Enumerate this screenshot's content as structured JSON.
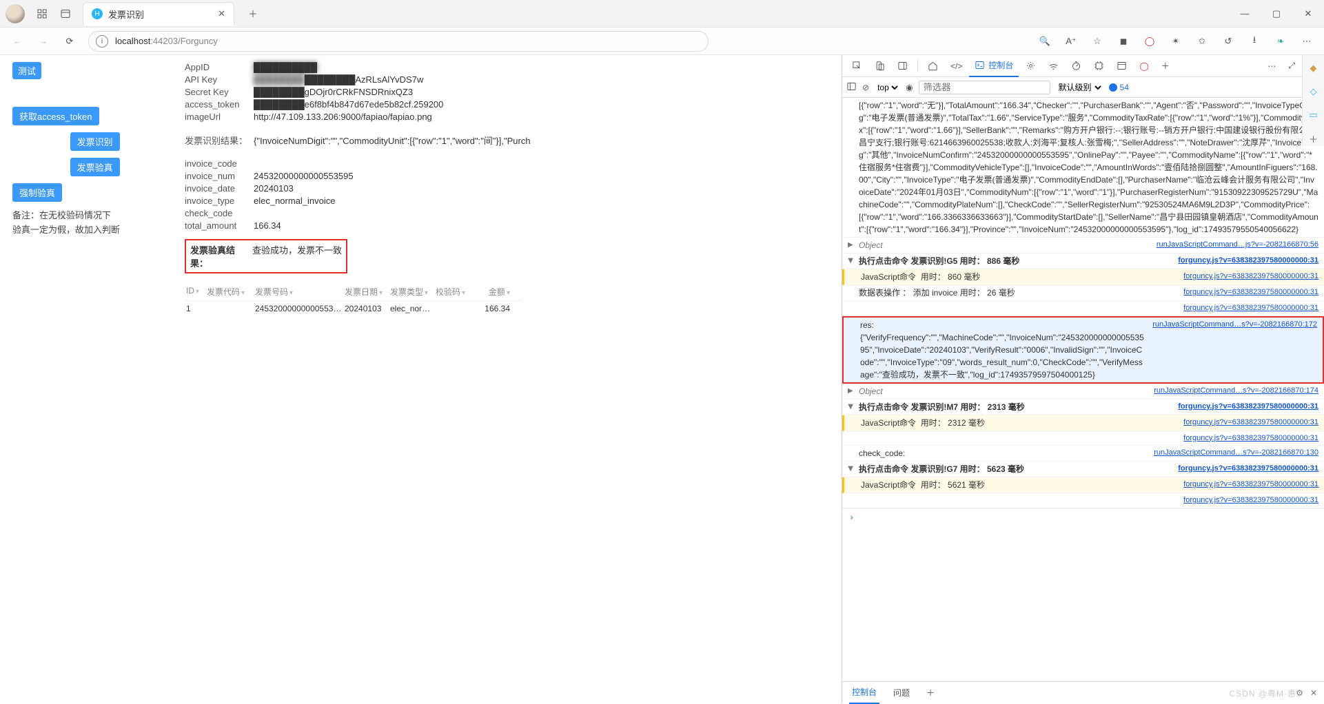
{
  "browser": {
    "tab_title": "发票识别",
    "url_host": "localhost",
    "url_port": ":44203",
    "url_path": "/Forguncy"
  },
  "sidebar": {
    "test": "测试",
    "get_token": "获取access_token",
    "recognize": "发票识别",
    "verify": "发票验真",
    "force_verify": "强制验真",
    "note1": "备注：在无校验码情况下",
    "note2": "验真一定为假，故加入判断"
  },
  "kv": {
    "appid_k": "AppID",
    "appid_v": "██████████",
    "apikey_k": "API Key",
    "apikey_v": "████████AzRLsAlYvDS7w",
    "secret_k": "Secret Key",
    "secret_v": "████████gDOjr0rCRkFNSDRnixQZ3",
    "token_k": "access_token",
    "token_v": "████████e6f8bf4b847d67ede5b82cf.259200",
    "imgurl_k": "imageUrl",
    "imgurl_v": "http://47.109.133.206:9000/fapiao/fapiao.png",
    "rres_k": "发票识别结果：",
    "rres_v": "{\"InvoiceNumDigit\":\"\",\"CommodityUnit\":[{\"row\":\"1\",\"word\":\"间\"}],\"Purch",
    "code_k": "invoice_code",
    "code_v": "",
    "num_k": "invoice_num",
    "num_v": "24532000000000553595",
    "date_k": "invoice_date",
    "date_v": "20240103",
    "type_k": "invoice_type",
    "type_v": "elec_normal_invoice",
    "check_k": "check_code",
    "check_v": "",
    "amt_k": "total_amount",
    "amt_v": "166.34"
  },
  "verify": {
    "k": "发票验真结果：",
    "v": "查验成功，发票不一致"
  },
  "table": {
    "h_id": "ID",
    "h_code": "发票代码",
    "h_num": "发票号码",
    "h_date": "发票日期",
    "h_type": "发票类型",
    "h_check": "校验码",
    "h_amt": "金额",
    "r_id": "1",
    "r_code": "",
    "r_num": "24532000000000553…",
    "r_date": "20240103",
    "r_type": "elec_nor…",
    "r_check": "",
    "r_amt": "166.34"
  },
  "devtools": {
    "tab_console": "控制台",
    "ctx": "top",
    "filter_ph": "筛选器",
    "level": "默认级别",
    "issues": "54",
    "bottom_console": "控制台",
    "bottom_issues": "问题"
  },
  "logs": {
    "big": "[{\"row\":\"1\",\"word\":\"无\"}],\"TotalAmount\":\"166.34\",\"Checker\":\"\",\"PurchaserBank\":\"\",\"Agent\":\"否\",\"Password\":\"\",\"InvoiceTypeOrg\":\"电子发票(普通发票)\",\"TotalTax\":\"1.66\",\"ServiceType\":\"服务\",\"CommodityTaxRate\":[{\"row\":\"1\",\"word\":\"1%\"}],\"CommodityTax\":[{\"row\":\"1\",\"word\":\"1.66\"}],\"SellerBank\":\"\",\"Remarks\":\"购方开户银行:--;银行账号:--销方开户银行:中国建设银行股份有限公司昌宁支行;银行账号:6214663960025538;收款人:刘海平;复核人:张雪梅;\",\"SellerAddress\":\"\",\"NoteDrawer\":\"沈厚芹\",\"InvoiceTag\":\"其他\",\"InvoiceNumConfirm\":\"24532000000000553595\",\"OnlinePay\":\"\",\"Payee\":\"\",\"CommodityName\":[{\"row\":\"1\",\"word\":\"*住宿服务*住宿费\"}],\"CommodityVehicleType\":[],\"InvoiceCode\":\"\",\"AmountInWords\":\"壹佰陆拾捌圆整\",\"AmountInFiguers\":\"168.00\",\"City\":\"\",\"InvoiceType\":\"电子发票(普通发票)\",\"CommodityEndDate\":[],\"PurchaserName\":\"临沧云峰会计服务有限公司\",\"InvoiceDate\":\"2024年01月03日\",\"CommodityNum\":[{\"row\":\"1\",\"word\":\"1\"}],\"PurchaserRegisterNum\":\"91530922309525729U\",\"MachineCode\":\"\",\"CommodityPlateNum\":[],\"CheckCode\":\"\",\"SellerRegisterNum\":\"92530524MA6M9L2D3P\",\"CommodityPrice\":[{\"row\":\"1\",\"word\":\"166.3366336633663\"}],\"CommodityStartDate\":[],\"SellerName\":\"昌宁县田园镇皇朝酒店\",\"CommodityAmount\":[{\"row\":\"1\",\"word\":\"166.34\"}],\"Province\":\"\",\"InvoiceNum\":\"24532000000000553595\"},\"log_id\":17493579550540056622}",
    "src_runjs56": "runJavaScriptCommand…js?v=-2082166870:56",
    "src_runjs172": "runJavaScriptCommand…s?v=-2082166870:172",
    "src_runjs174": "runJavaScriptCommand…s?v=-2082166870:174",
    "src_runjs130": "runJavaScriptCommand…s?v=-2082166870:130",
    "src_forg": "forguncy.js?v=638382397580000000:31",
    "obj": "Object",
    "g5": "执行点击命令 发票识别!G5 用时： 886 毫秒",
    "g5a": "JavaScript命令  用时： 860 毫秒",
    "g5b": "数据表操作 ： 添加 invoice 用时： 26 毫秒",
    "res_label": "res:",
    "res_body": "{\"VerifyFrequency\":\"\",\"MachineCode\":\"\",\"InvoiceNum\":\"24532000000000553595\",\"InvoiceDate\":\"20240103\",\"VerifyResult\":\"0006\",\"InvalidSign\":\"\",\"InvoiceCode\":\"\",\"InvoiceType\":\"09\",\"words_result_num\":0,\"CheckCode\":\"\",\"VerifyMessage\":\"查验成功，发票不一致\",\"log_id\":17493579597504000125}",
    "m7": "执行点击命令 发票识别!M7 用时： 2313 毫秒",
    "m7a": "JavaScript命令  用时： 2312 毫秒",
    "checkcode": "check_code:",
    "g7": "执行点击命令 发票识别!G7 用时： 5623 毫秒",
    "g7a": "JavaScript命令  用时： 5621 毫秒"
  },
  "watermark": "CSDN @粤M·惠"
}
